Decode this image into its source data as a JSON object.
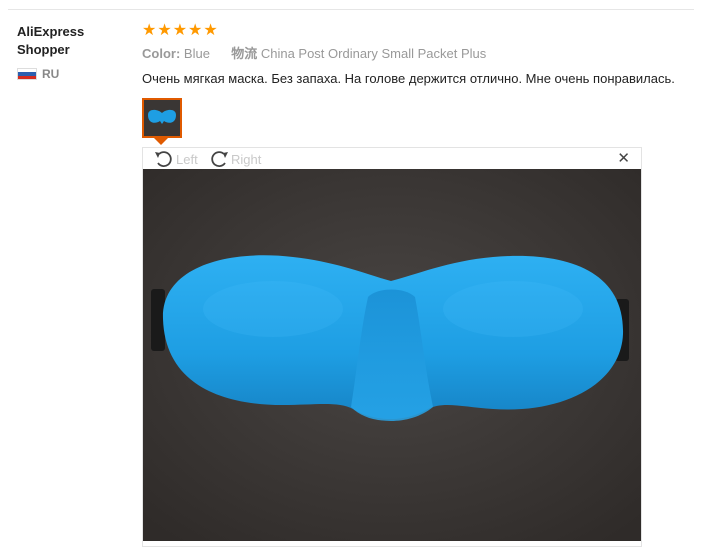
{
  "reviewer": {
    "name": "AliExpress Shopper",
    "country_code": "RU"
  },
  "review": {
    "rating": 5,
    "stars": [
      "★",
      "★",
      "★",
      "★",
      "★"
    ],
    "color_label": "Color:",
    "color_value": "Blue",
    "logistics_label": "物流",
    "logistics_value": "China Post Ordinary Small Packet Plus",
    "text": "Очень мягкая маска. Без запаха. На голове держится отлично. Мне очень понравилась."
  },
  "viewer": {
    "rotate_left_label": "Left",
    "rotate_right_label": "Right",
    "close_symbol": "✕"
  },
  "colors": {
    "star": "#ff9900",
    "thumb_border": "#e05a00",
    "mask_blue": "#1e9ee3",
    "photo_background": "#3c3836"
  }
}
